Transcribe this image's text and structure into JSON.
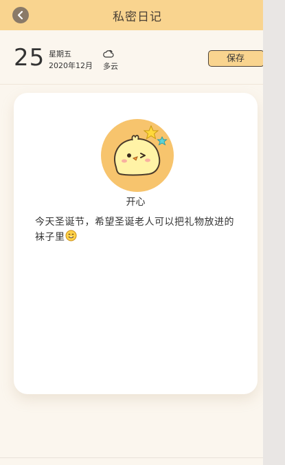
{
  "header": {
    "title": "私密日记"
  },
  "date": {
    "day": "25",
    "weekday": "星期五",
    "year_month": "2020年12月"
  },
  "weather": {
    "icon": "cloudy-icon",
    "label": "多云"
  },
  "save_label": "保存",
  "entry": {
    "mood_icon": "happy-chick-icon",
    "mood_label": "开心",
    "content": "今天圣诞节，希望圣诞老人可以把礼物放进的袜子里",
    "emoji": "smiling-face-icon"
  },
  "colors": {
    "header_bg": "#f9d48f",
    "page_bg": "#fbf6ee",
    "avatar_bg": "#f7c46d",
    "star_yellow": "#ffd83a",
    "star_teal": "#5ed3d6"
  }
}
